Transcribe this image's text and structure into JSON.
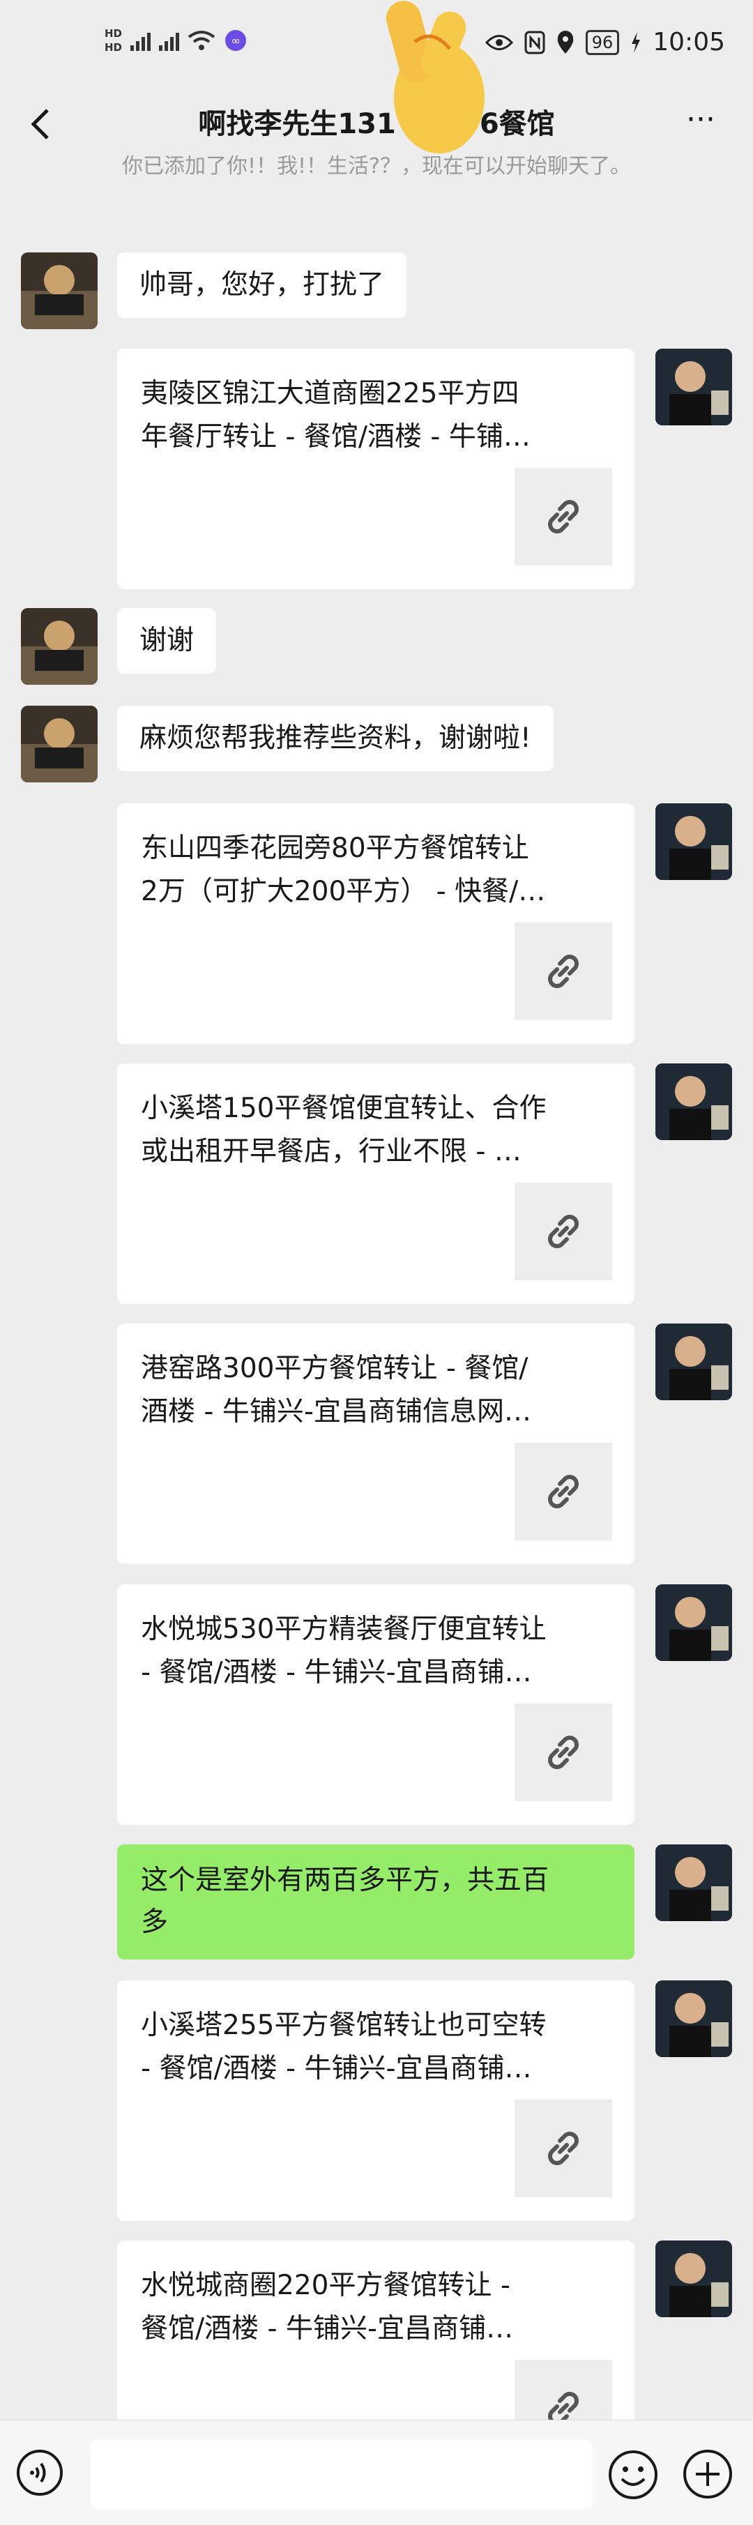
{
  "status_bar": {
    "left_labels": [
      "HD",
      "HD"
    ],
    "battery": "96",
    "time": "10:05"
  },
  "header": {
    "title": "啊找李先生131",
    "title_tail": "6餐馆",
    "more_label": "···"
  },
  "system_tip": "你已添加了你!！我!！生活?？，现在可以开始聊天了。",
  "messages": [
    {
      "side": "left",
      "type": "text",
      "text": "帅哥，您好，打扰了"
    },
    {
      "side": "right",
      "type": "link",
      "line1": "夷陵区锦江大道商圈225平方四",
      "line2": "年餐厅转让 - 餐馆/酒楼 - 牛铺…"
    },
    {
      "side": "left",
      "type": "text",
      "text": "谢谢"
    },
    {
      "side": "left",
      "type": "text",
      "text": "麻烦您帮我推荐些资料，谢谢啦!"
    },
    {
      "side": "right",
      "type": "link",
      "line1": "东山四季花园旁80平方餐馆转让",
      "line2": "2万（可扩大200平方） - 快餐/…"
    },
    {
      "side": "right",
      "type": "link",
      "line1": "小溪塔150平餐馆便宜转让、合作",
      "line2": "或出租开早餐店，行业不限 - …"
    },
    {
      "side": "right",
      "type": "link",
      "line1": "港窑路300平方餐馆转让 - 餐馆/",
      "line2": "酒楼 - 牛铺兴-宜昌商铺信息网…"
    },
    {
      "side": "right",
      "type": "link",
      "line1": "水悦城530平方精装餐厅便宜转让",
      "line2": "- 餐馆/酒楼 - 牛铺兴-宜昌商铺…"
    },
    {
      "side": "right",
      "type": "green",
      "line1": "这个是室外有两百多平方，共五百",
      "line2": "多"
    },
    {
      "side": "right",
      "type": "link",
      "line1": "小溪塔255平方餐馆转让也可空转",
      "line2": "- 餐馆/酒楼 - 牛铺兴-宜昌商铺…"
    },
    {
      "side": "right",
      "type": "link",
      "line1": "水悦城商圈220平方餐馆转让 -",
      "line2": "餐馆/酒楼 - 牛铺兴-宜昌商铺…"
    }
  ],
  "colors": {
    "background": "#ededed",
    "bubble": "#ffffff",
    "sent_bubble": "#95ec69"
  },
  "icons": [
    "back-arrow-icon",
    "more-icon",
    "link-icon",
    "voice-icon",
    "emoji-icon",
    "plus-icon"
  ]
}
